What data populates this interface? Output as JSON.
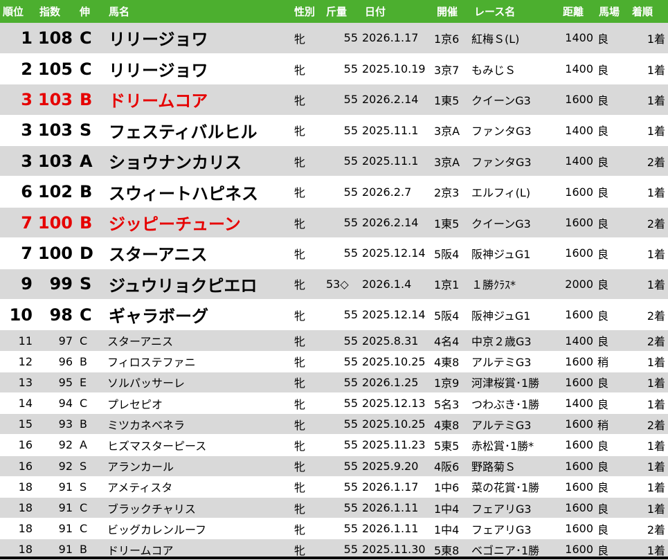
{
  "headers": {
    "rank": "順位",
    "index": "指数",
    "grade": "伸",
    "name": "馬名",
    "sex": "性別",
    "weight": "斤量",
    "date": "日付",
    "venue": "開催",
    "race": "レース名",
    "distance": "距離",
    "track": "馬場",
    "finish": "着順"
  },
  "rows": [
    {
      "rank": "1",
      "index": "108",
      "grade": "C",
      "name": "リリージョワ",
      "sex": "牝",
      "weight": "55",
      "date": "2026.1.17",
      "venue": "1京6",
      "race": "紅梅Ｓ(L)",
      "distance": "1400",
      "track": "良",
      "finish": "1着",
      "size": "big",
      "shade": true,
      "red": false
    },
    {
      "rank": "2",
      "index": "105",
      "grade": "C",
      "name": "リリージョワ",
      "sex": "牝",
      "weight": "55",
      "date": "2025.10.19",
      "venue": "3京7",
      "race": "もみじＳ",
      "distance": "1400",
      "track": "良",
      "finish": "1着",
      "size": "big",
      "shade": false,
      "red": false
    },
    {
      "rank": "3",
      "index": "103",
      "grade": "B",
      "name": "ドリームコア",
      "sex": "牝",
      "weight": "55",
      "date": "2026.2.14",
      "venue": "1東5",
      "race": "クイーンG3",
      "distance": "1600",
      "track": "良",
      "finish": "1着",
      "size": "big",
      "shade": true,
      "red": true
    },
    {
      "rank": "3",
      "index": "103",
      "grade": "S",
      "name": "フェスティバルヒル",
      "sex": "牝",
      "weight": "55",
      "date": "2025.11.1",
      "venue": "3京A",
      "race": "ファンタG3",
      "distance": "1400",
      "track": "良",
      "finish": "1着",
      "size": "big",
      "shade": false,
      "red": false
    },
    {
      "rank": "3",
      "index": "103",
      "grade": "A",
      "name": "ショウナンカリス",
      "sex": "牝",
      "weight": "55",
      "date": "2025.11.1",
      "venue": "3京A",
      "race": "ファンタG3",
      "distance": "1400",
      "track": "良",
      "finish": "2着",
      "size": "big",
      "shade": true,
      "red": false
    },
    {
      "rank": "6",
      "index": "102",
      "grade": "B",
      "name": "スウィートハピネス",
      "sex": "牝",
      "weight": "55",
      "date": "2026.2.7",
      "venue": "2京3",
      "race": "エルフィ(L)",
      "distance": "1600",
      "track": "良",
      "finish": "1着",
      "size": "big",
      "shade": false,
      "red": false
    },
    {
      "rank": "7",
      "index": "100",
      "grade": "B",
      "name": "ジッピーチューン",
      "sex": "牝",
      "weight": "55",
      "date": "2026.2.14",
      "venue": "1東5",
      "race": "クイーンG3",
      "distance": "1600",
      "track": "良",
      "finish": "2着",
      "size": "big",
      "shade": true,
      "red": true
    },
    {
      "rank": "7",
      "index": "100",
      "grade": "D",
      "name": "スターアニス",
      "sex": "牝",
      "weight": "55",
      "date": "2025.12.14",
      "venue": "5阪4",
      "race": "阪神ジュG1",
      "distance": "1600",
      "track": "良",
      "finish": "1着",
      "size": "big",
      "shade": false,
      "red": false
    },
    {
      "rank": "9",
      "index": "99",
      "grade": "S",
      "name": "ジュウリョクピエロ",
      "sex": "牝",
      "weight": "53◇",
      "date": "2026.1.4",
      "venue": "1京1",
      "race": "１勝ｸﾗｽ*",
      "distance": "2000",
      "track": "良",
      "finish": "1着",
      "size": "big",
      "shade": true,
      "red": false,
      "weight_left": true
    },
    {
      "rank": "10",
      "index": "98",
      "grade": "C",
      "name": "ギャラボーグ",
      "sex": "牝",
      "weight": "55",
      "date": "2025.12.14",
      "venue": "5阪4",
      "race": "阪神ジュG1",
      "distance": "1600",
      "track": "良",
      "finish": "2着",
      "size": "big",
      "shade": false,
      "red": false
    },
    {
      "rank": "11",
      "index": "97",
      "grade": "C",
      "name": "スターアニス",
      "sex": "牝",
      "weight": "55",
      "date": "2025.8.31",
      "venue": "4名4",
      "race": "中京２歳G3",
      "distance": "1400",
      "track": "良",
      "finish": "2着",
      "size": "small",
      "shade": true,
      "red": false
    },
    {
      "rank": "12",
      "index": "96",
      "grade": "B",
      "name": "フィロステファニ",
      "sex": "牝",
      "weight": "55",
      "date": "2025.10.25",
      "venue": "4東8",
      "race": "アルテミG3",
      "distance": "1600",
      "track": "稍",
      "finish": "1着",
      "size": "small",
      "shade": false,
      "red": false
    },
    {
      "rank": "13",
      "index": "95",
      "grade": "E",
      "name": "ソルパッサーレ",
      "sex": "牝",
      "weight": "55",
      "date": "2026.1.25",
      "venue": "1京9",
      "race": "河津桜賞･1勝",
      "distance": "1600",
      "track": "良",
      "finish": "1着",
      "size": "small",
      "shade": true,
      "red": false
    },
    {
      "rank": "14",
      "index": "94",
      "grade": "C",
      "name": "プレセピオ",
      "sex": "牝",
      "weight": "55",
      "date": "2025.12.13",
      "venue": "5名3",
      "race": "つわぶき･1勝",
      "distance": "1400",
      "track": "良",
      "finish": "1着",
      "size": "small",
      "shade": false,
      "red": false
    },
    {
      "rank": "15",
      "index": "93",
      "grade": "B",
      "name": "ミツカネベネラ",
      "sex": "牝",
      "weight": "55",
      "date": "2025.10.25",
      "venue": "4東8",
      "race": "アルテミG3",
      "distance": "1600",
      "track": "稍",
      "finish": "2着",
      "size": "small",
      "shade": true,
      "red": false
    },
    {
      "rank": "16",
      "index": "92",
      "grade": "A",
      "name": "ヒズマスターピース",
      "sex": "牝",
      "weight": "55",
      "date": "2025.11.23",
      "venue": "5東5",
      "race": "赤松賞･1勝*",
      "distance": "1600",
      "track": "良",
      "finish": "1着",
      "size": "small",
      "shade": false,
      "red": false
    },
    {
      "rank": "16",
      "index": "92",
      "grade": "S",
      "name": "アランカール",
      "sex": "牝",
      "weight": "55",
      "date": "2025.9.20",
      "venue": "4阪6",
      "race": "野路菊Ｓ",
      "distance": "1600",
      "track": "良",
      "finish": "1着",
      "size": "small",
      "shade": true,
      "red": false
    },
    {
      "rank": "18",
      "index": "91",
      "grade": "S",
      "name": "アメティスタ",
      "sex": "牝",
      "weight": "55",
      "date": "2026.1.17",
      "venue": "1中6",
      "race": "菜の花賞･1勝",
      "distance": "1600",
      "track": "良",
      "finish": "1着",
      "size": "small",
      "shade": false,
      "red": false
    },
    {
      "rank": "18",
      "index": "91",
      "grade": "C",
      "name": "ブラックチャリス",
      "sex": "牝",
      "weight": "55",
      "date": "2026.1.11",
      "venue": "1中4",
      "race": "フェアリG3",
      "distance": "1600",
      "track": "良",
      "finish": "1着",
      "size": "small",
      "shade": true,
      "red": false
    },
    {
      "rank": "18",
      "index": "91",
      "grade": "C",
      "name": "ビッグカレンルーフ",
      "sex": "牝",
      "weight": "55",
      "date": "2026.1.11",
      "venue": "1中4",
      "race": "フェアリG3",
      "distance": "1600",
      "track": "良",
      "finish": "2着",
      "size": "small",
      "shade": false,
      "red": false
    },
    {
      "rank": "18",
      "index": "91",
      "grade": "B",
      "name": "ドリームコア",
      "sex": "牝",
      "weight": "55",
      "date": "2025.11.30",
      "venue": "5東8",
      "race": "ベゴニア･1勝",
      "distance": "1600",
      "track": "良",
      "finish": "1着",
      "size": "small",
      "shade": true,
      "red": false
    }
  ],
  "colors": {
    "header_bg": "#4caf2f",
    "shade": "#d9d9d9",
    "highlight": "#e60000"
  }
}
